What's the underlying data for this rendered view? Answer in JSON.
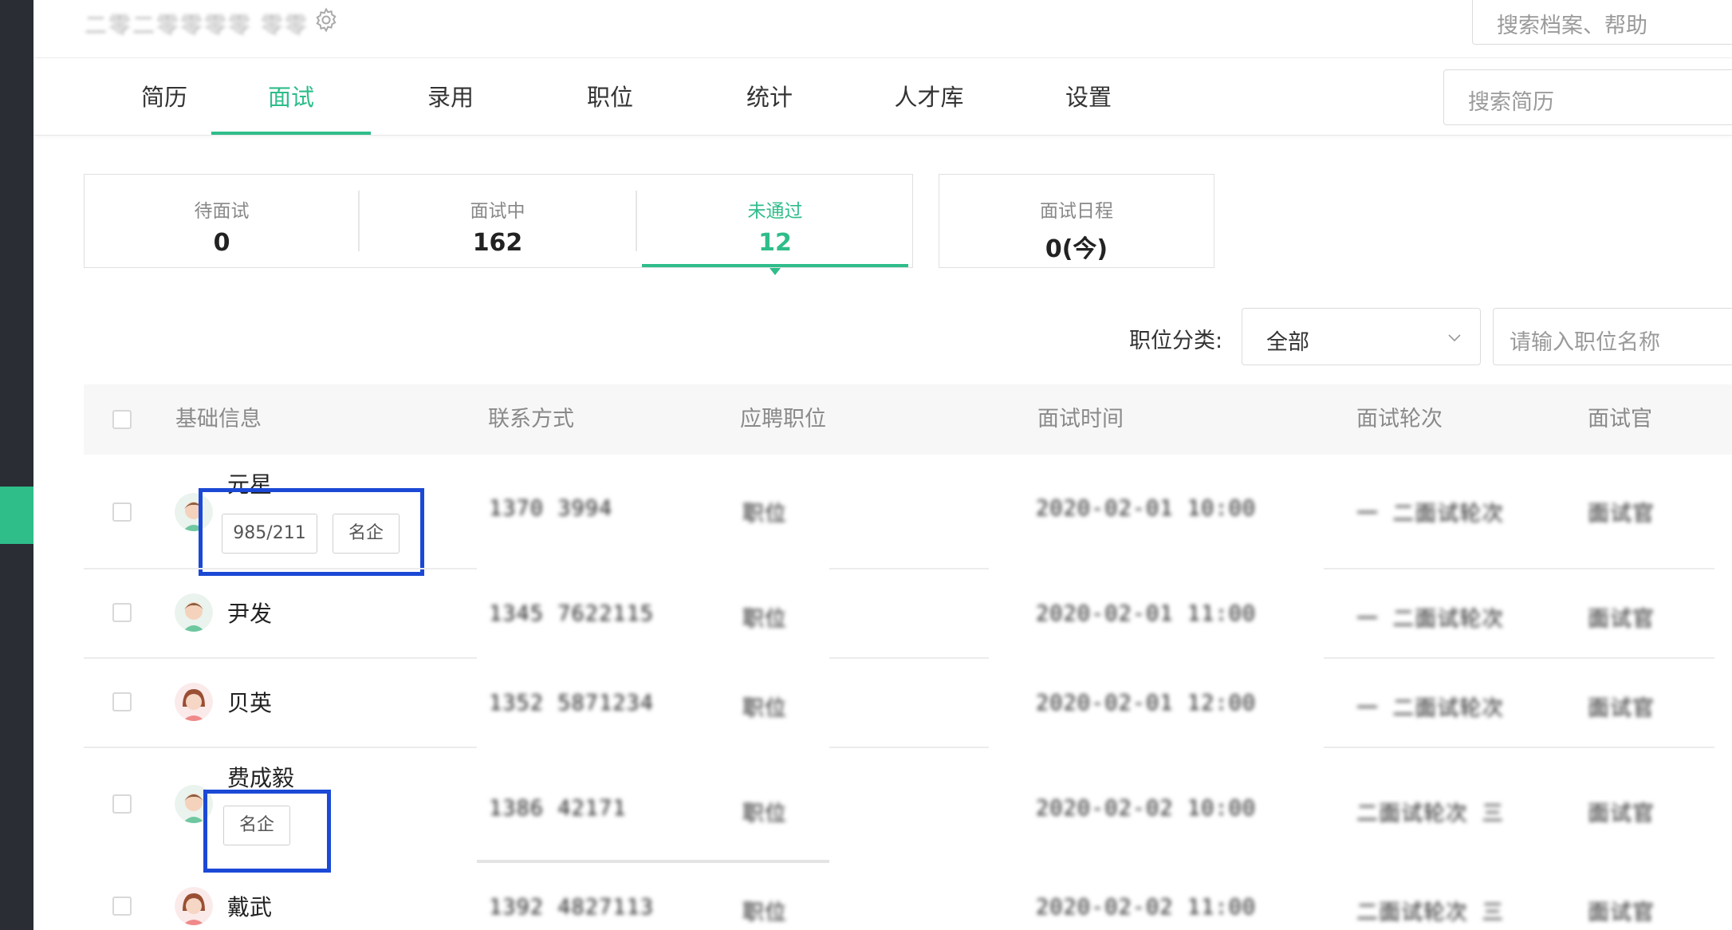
{
  "topbar": {
    "org_name": "二零二零零零零 零零",
    "search_placeholder": "搜索档案、帮助"
  },
  "nav": {
    "tabs": [
      {
        "label": "简历",
        "active": false
      },
      {
        "label": "面试",
        "active": true
      },
      {
        "label": "录用",
        "active": false
      },
      {
        "label": "职位",
        "active": false
      },
      {
        "label": "统计",
        "active": false
      },
      {
        "label": "人才库",
        "active": false
      },
      {
        "label": "设置",
        "active": false
      }
    ],
    "resume_search_placeholder": "搜索简历"
  },
  "stats": {
    "pending": {
      "label": "待面试",
      "value": "0"
    },
    "in_progress": {
      "label": "面试中",
      "value": "162"
    },
    "failed": {
      "label": "未通过",
      "value": "12"
    },
    "schedule": {
      "label": "面试日程",
      "value": "0(今)"
    }
  },
  "filter": {
    "category_label": "职位分类:",
    "category_value": "全部",
    "position_placeholder": "请输入职位名称"
  },
  "table": {
    "columns": [
      "基础信息",
      "联系方式",
      "应聘职位",
      "面试时间",
      "面试轮次",
      "面试官"
    ],
    "rows": [
      {
        "name": "元星",
        "tags": [
          "985/211",
          "名企"
        ],
        "contact": "1370 3994",
        "position": "职位",
        "time": "2020-02-01 10:00",
        "round": "一 二面试轮次",
        "interviewer": "面试官"
      },
      {
        "name": "尹发",
        "tags": [],
        "contact": "1345 7622115",
        "position": "职位",
        "time": "2020-02-01 11:00",
        "round": "一 二面试轮次",
        "interviewer": "面试官"
      },
      {
        "name": "贝英",
        "tags": [],
        "contact": "1352 5871234",
        "position": "职位",
        "time": "2020-02-01 12:00",
        "round": "一 二面试轮次",
        "interviewer": "面试官"
      },
      {
        "name": "费成毅",
        "tags": [
          "名企"
        ],
        "contact": "1386 42171",
        "position": "职位",
        "time": "2020-02-02 10:00",
        "round": "二面试轮次 三",
        "interviewer": "面试官"
      },
      {
        "name": "戴武",
        "tags": [],
        "contact": "1392 4827113",
        "position": "职位",
        "time": "2020-02-02 11:00",
        "round": "二面试轮次 三",
        "interviewer": "面试官"
      }
    ]
  },
  "colors": {
    "accent": "#2fbd8a",
    "highlight": "#1b49d6",
    "rail": "#2a2d33"
  },
  "icons": {
    "settings": "gear-icon",
    "dropdown": "chevron-down-icon",
    "avatar_male": "male-avatar-icon",
    "avatar_female": "female-avatar-icon"
  }
}
